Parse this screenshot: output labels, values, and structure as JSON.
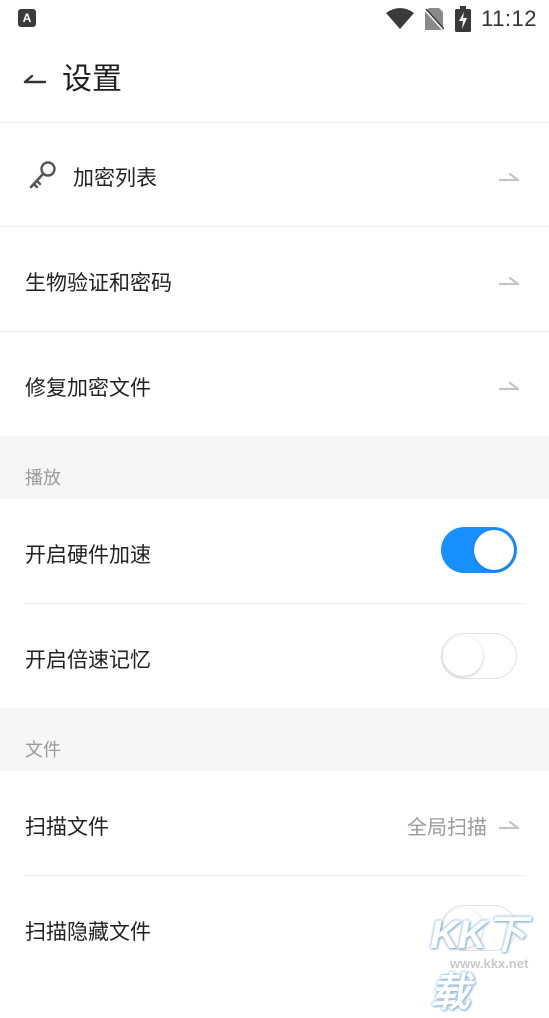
{
  "status_bar": {
    "badge": "A",
    "time": "11:12",
    "icons": [
      "wifi-icon",
      "no-sim-icon",
      "battery-charging-icon"
    ]
  },
  "toolbar": {
    "title": "设置",
    "back_icon": "back-arrow-icon"
  },
  "encryption": {
    "items": [
      {
        "label": "加密列表",
        "icon": "key-icon"
      },
      {
        "label": "生物验证和密码"
      },
      {
        "label": "修复加密文件"
      }
    ]
  },
  "playback": {
    "section_title": "播放",
    "items": [
      {
        "label": "开启硬件加速",
        "enabled": true
      },
      {
        "label": "开启倍速记忆",
        "enabled": false
      }
    ]
  },
  "files": {
    "section_title": "文件",
    "items": [
      {
        "label": "扫描文件",
        "value": "全局扫描"
      },
      {
        "label": "扫描隐藏文件",
        "enabled": false
      }
    ]
  },
  "watermark": {
    "text": "KK下载",
    "url": "www.kkx.net"
  },
  "colors": {
    "accent": "#1890ff",
    "section_bg": "#f6f6f6",
    "secondary_text": "#9a9a9a"
  }
}
